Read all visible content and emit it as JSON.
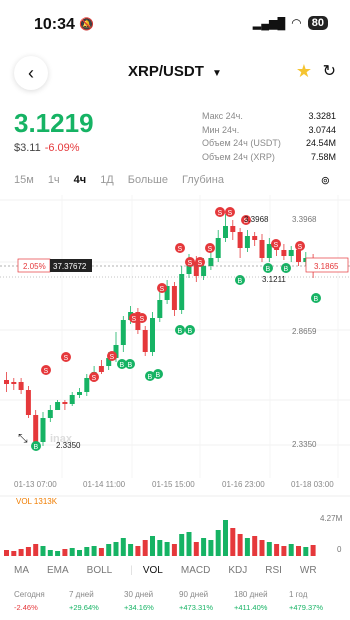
{
  "status": {
    "time": "10:34",
    "battery": "80"
  },
  "header": {
    "pair": "XRP/USDT",
    "dropdown_icon": "caret-down-icon"
  },
  "price": {
    "last": "3.1219",
    "usd": "$3.11",
    "change": "-6.09%"
  },
  "stats": [
    {
      "label": "Макс 24ч.",
      "value": "3.3281"
    },
    {
      "label": "Мин 24ч.",
      "value": "3.0744"
    },
    {
      "label": "Объем 24ч (USDT)",
      "value": "24.54M"
    },
    {
      "label": "Объем 24ч (XRP)",
      "value": "7.58M"
    }
  ],
  "timeframes": [
    "15м",
    "1ч",
    "4ч",
    "1Д",
    "Больше",
    "Глубина"
  ],
  "active_timeframe": "4ч",
  "chart": {
    "price_axis": [
      "3.3968",
      "3.1865",
      "2.8659",
      "2.3350"
    ],
    "date_axis": [
      "01-13 07:00",
      "01-14 11:00",
      "01-15 15:00",
      "01-16 23:00",
      "01-18 03:00"
    ],
    "current_tag": "3.1865",
    "left_tag_pct": "2.05%",
    "left_tag_price": "37.37672",
    "high_label": "3.3968",
    "low_label": "2.3350",
    "mid_label": "3.1211",
    "watermark": "inax",
    "vol_label": "VOL 1313K",
    "vol_axis_top": "4.27M",
    "vol_axis_bottom": "0",
    "up_color": "#16b364",
    "down_color": "#e5383b"
  },
  "indicators": [
    "MA",
    "EMA",
    "BOLL",
    "VOL",
    "MACD",
    "KDJ",
    "RSI",
    "WR"
  ],
  "active_indicator": "VOL",
  "performance": [
    {
      "label": "Сегодня",
      "value": "-2.46%"
    },
    {
      "label": "7 дней",
      "value": "+29.64%"
    },
    {
      "label": "30 дней",
      "value": "+34.16%"
    },
    {
      "label": "90 дней",
      "value": "+473.31%"
    },
    {
      "label": "180 дней",
      "value": "+411.40%"
    },
    {
      "label": "1 год",
      "value": "+479.37%"
    }
  ]
}
